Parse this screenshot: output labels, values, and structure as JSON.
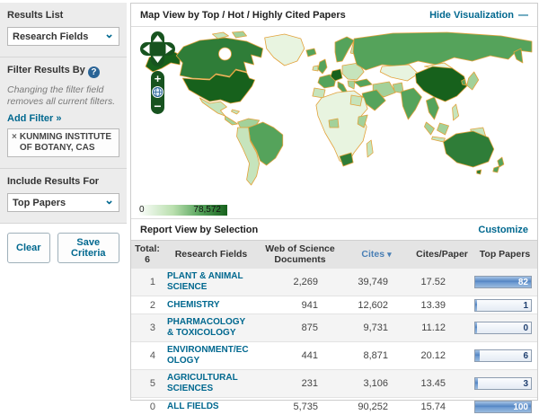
{
  "colors": {
    "link": "#00688f",
    "sort": "#4a7fb5",
    "panel_gray": "#ececec",
    "control_green": "#17531f",
    "map_darkest": "#17611c",
    "map_dark": "#2f7d38",
    "map_mid": "#55a35b",
    "map_lightmid": "#a3d19a",
    "map_light": "#c6e4bc",
    "map_pale": "#e8f4e0",
    "map_stroke": "#e2a23b",
    "bar_blue": "#5385c3"
  },
  "icons": {
    "chevron": "⌄",
    "help": "?",
    "close": "×",
    "minus": "—",
    "sort": "▾"
  },
  "sidebar": {
    "results_list_label": "Results List",
    "results_list_value": "Research Fields",
    "filter_by_label": "Filter Results By",
    "filter_note": "Changing the filter field removes all current filters.",
    "add_filter_label": "Add Filter »",
    "filter_chip": "KUNMING INSTITUTE OF BOTANY, CAS",
    "include_label": "Include Results For",
    "include_value": "Top Papers",
    "clear_label": "Clear",
    "save_label": "Save Criteria"
  },
  "map": {
    "title": "Map View by Top / Hot / Highly Cited Papers",
    "hide_link": "Hide Visualization",
    "legend": {
      "min": "0",
      "max": "78,572"
    }
  },
  "report": {
    "title": "Report View by Selection",
    "customize_label": "Customize",
    "total_label": "Total:",
    "total_value": "6",
    "columns": [
      "Research Fields",
      "Web of Science Documents",
      "Cites",
      "Cites/Paper",
      "Top Papers"
    ],
    "rows": [
      {
        "rank": "1",
        "field": "PLANT & ANIMAL SCIENCE",
        "docs": "2,269",
        "cites": "39,749",
        "cites_per_paper": "17.52",
        "top_papers": 82
      },
      {
        "rank": "2",
        "field": "CHEMISTRY",
        "docs": "941",
        "cites": "12,602",
        "cites_per_paper": "13.39",
        "top_papers": 1
      },
      {
        "rank": "3",
        "field": "PHARMACOLOGY & TOXICOLOGY",
        "docs": "875",
        "cites": "9,731",
        "cites_per_paper": "11.12",
        "top_papers": 0
      },
      {
        "rank": "4",
        "field": "ENVIRONMENT/ECOLOGY",
        "docs": "441",
        "cites": "8,871",
        "cites_per_paper": "20.12",
        "top_papers": 6
      },
      {
        "rank": "5",
        "field": "AGRICULTURAL SCIENCES",
        "docs": "231",
        "cites": "3,106",
        "cites_per_paper": "13.45",
        "top_papers": 3
      },
      {
        "rank": "0",
        "field": "ALL FIELDS",
        "docs": "5,735",
        "cites": "90,252",
        "cites_per_paper": "15.74",
        "top_papers": 100
      }
    ]
  }
}
